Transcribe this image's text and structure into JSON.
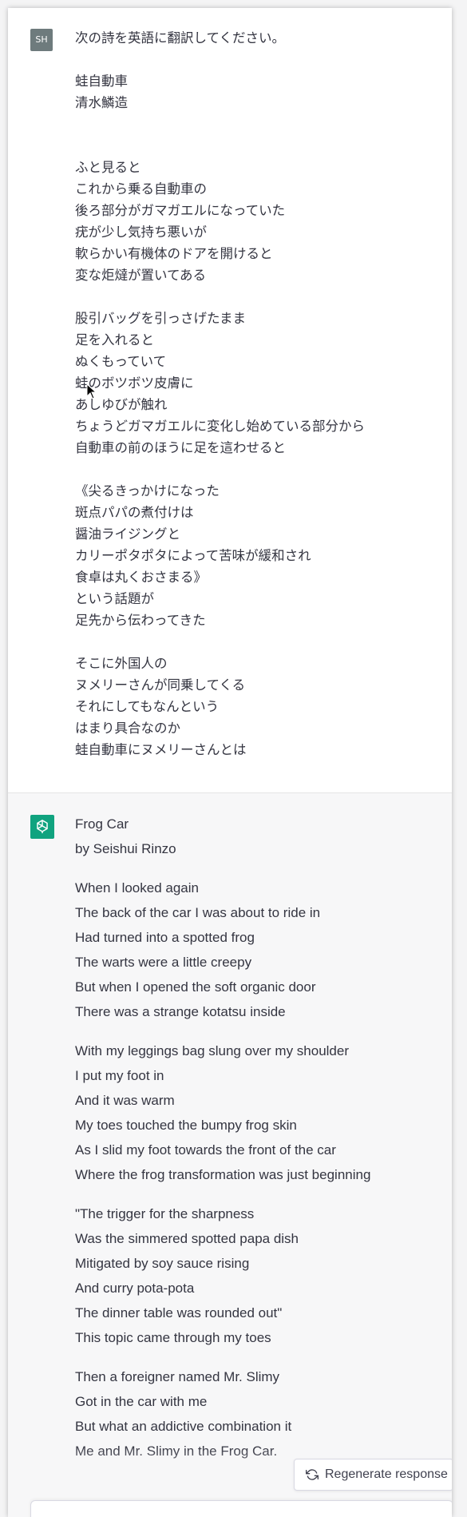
{
  "user": {
    "avatar_initials": "SH",
    "lines": [
      "次の詩を英語に翻訳してください。",
      "",
      "蛙自動車",
      "清水鱗造",
      "",
      "",
      "ふと見ると",
      "これから乗る自動車の",
      "後ろ部分がガマガエルになっていた",
      "疣が少し気持ち悪いが",
      "軟らかい有機体のドアを開けると",
      "変な炬燵が置いてある",
      "",
      "股引バッグを引っさげたまま",
      "足を入れると",
      "ぬくもっていて",
      "蛙のボツボツ皮膚に",
      "あしゆびが触れ",
      "ちょうどガマガエルに変化し始めている部分から",
      "自動車の前のほうに足を這わせると",
      "",
      "《尖るきっかけになった",
      "斑点パパの煮付けは",
      "醤油ライジングと",
      "カリーポタポタによって苦味が緩和され",
      "食卓は丸くおさまる》",
      "という話題が",
      "足先から伝わってきた",
      "",
      "そこに外国人の",
      "ヌメリーさんが同乗してくる",
      "それにしてもなんという",
      "はまり具合なのか",
      "蛙自動車にヌメリーさんとは"
    ]
  },
  "assistant": {
    "paragraphs": [
      [
        "Frog Car",
        "by Seishui Rinzo"
      ],
      [
        "When I looked again",
        "The back of the car I was about to ride in",
        "Had turned into a spotted frog",
        "The warts were a little creepy",
        "But when I opened the soft organic door",
        "There was a strange kotatsu inside"
      ],
      [
        "With my leggings bag slung over my shoulder",
        "I put my foot in",
        "And it was warm",
        "My toes touched the bumpy frog skin",
        "As I slid my foot towards the front of the car",
        "Where the frog transformation was just beginning"
      ],
      [
        "\"The trigger for the sharpness",
        "Was the simmered spotted papa dish",
        "Mitigated by soy sauce rising",
        "And curry pota-pota",
        "The dinner table was rounded out\"",
        "This topic came through my toes"
      ],
      [
        "Then a foreigner named Mr. Slimy",
        "Got in the car with me",
        "But what an addictive combination it",
        "Me and Mr. Slimy in the Frog Car."
      ]
    ]
  },
  "controls": {
    "regenerate_label": "Regenerate response"
  },
  "colors": {
    "assistant_avatar": "#10a37f",
    "user_avatar": "#6e7b7d",
    "assistant_background": "#f7f7f8"
  }
}
